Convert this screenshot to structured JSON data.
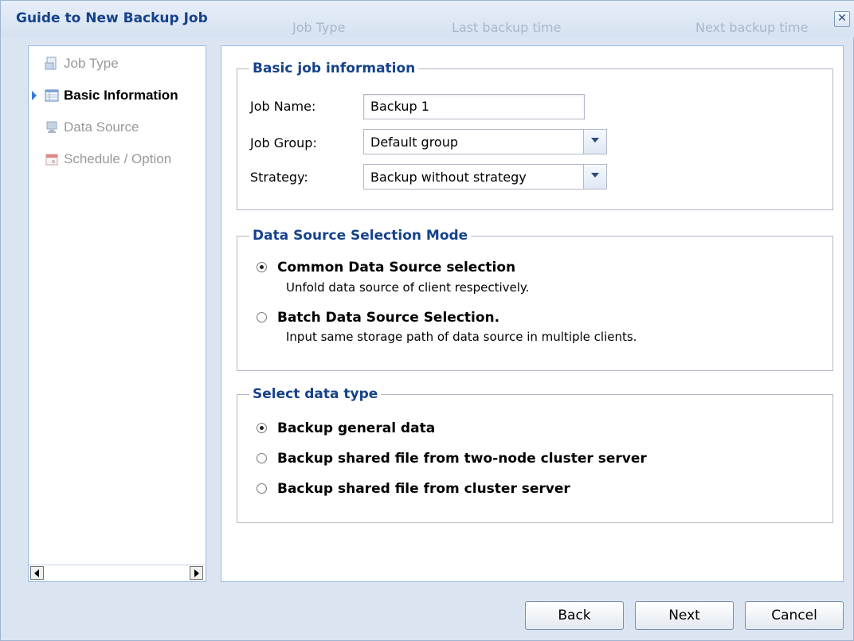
{
  "dialog": {
    "title": "Guide to New Backup Job",
    "close_glyph": "✕"
  },
  "background_columns": [
    "Job Type",
    "Last backup time",
    "Next backup time"
  ],
  "nav": {
    "items": [
      {
        "label": "Job Type",
        "icon": "job-type-icon",
        "active": false
      },
      {
        "label": "Basic Information",
        "icon": "table-icon",
        "active": true
      },
      {
        "label": "Data Source",
        "icon": "monitor-icon",
        "active": false
      },
      {
        "label": "Schedule / Option",
        "icon": "calendar-icon",
        "active": false
      }
    ]
  },
  "basic": {
    "legend": "Basic job information",
    "job_name_label": "Job Name:",
    "job_name_value": "Backup 1",
    "job_group_label": "Job Group:",
    "job_group_value": "Default group",
    "strategy_label": "Strategy:",
    "strategy_value": "Backup without strategy"
  },
  "datasource": {
    "legend": "Data Source Selection Mode",
    "options": [
      {
        "title": "Common Data Source selection",
        "desc": "Unfold data source of client respectively.",
        "checked": true
      },
      {
        "title": "Batch Data Source Selection.",
        "desc": "Input same storage path of data source in multiple clients.",
        "checked": false
      }
    ]
  },
  "datatype": {
    "legend": "Select data type",
    "options": [
      {
        "title": "Backup general data",
        "checked": true
      },
      {
        "title": "Backup shared file from two-node cluster server",
        "checked": false
      },
      {
        "title": "Backup shared file from cluster server",
        "checked": false
      }
    ]
  },
  "footer": {
    "back": "Back",
    "next": "Next",
    "cancel": "Cancel"
  },
  "colors": {
    "title": "#15428b",
    "accent_arrow": "#3a7bd5",
    "panel_border": "#99bbe8"
  }
}
